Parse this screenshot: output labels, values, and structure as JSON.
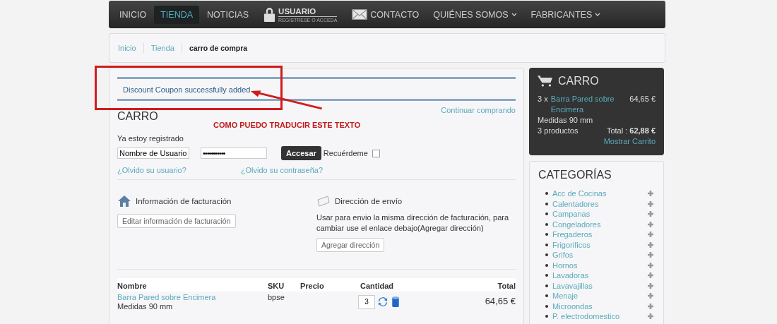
{
  "nav": [
    {
      "kind": "plain",
      "label": "INICIO",
      "selected": false
    },
    {
      "kind": "plain",
      "label": "TIENDA",
      "selected": true
    },
    {
      "kind": "plain",
      "label": "NOTICIAS",
      "selected": false
    },
    {
      "kind": "lock",
      "label": "USUARIO",
      "sub": "REGISTRESE O ACCEDA",
      "selected": false
    },
    {
      "kind": "mail",
      "label": "CONTACTO",
      "selected": false
    },
    {
      "kind": "dropdown",
      "label": "QUIÉNES SOMOS",
      "selected": false
    },
    {
      "kind": "dropdown",
      "label": "FABRICANTES",
      "selected": false
    }
  ],
  "breadcrumb": [
    {
      "label": "Inicio",
      "kind": "link"
    },
    {
      "label": "Tienda",
      "kind": "link"
    },
    {
      "label": "carro de compra",
      "kind": "current"
    }
  ],
  "message": "Discount Coupon successfully added",
  "annotation": "COMO PUEDO TRADUCIR ESTE TEXTO",
  "cart": {
    "title": "CARRO",
    "continue": "Continuar comprando",
    "login": {
      "label": "Ya estoy registrado",
      "username": "Nombre de Usuario",
      "password": "•••••••••••",
      "button": "Accesar",
      "remember": "Recuérdeme",
      "remember_checked": false,
      "forgot_user": "¿Olvido su usuario?",
      "forgot_password": "¿Olvido su contraseña?"
    },
    "billing": {
      "title": "Información de facturación",
      "button": "Editar información de facturación"
    },
    "shipping": {
      "title": "Dirección de envío",
      "text": "Usar para envio la misma dirección de facturación, para cambiar use el enlace debajo(Agregar dirección)",
      "button": "Agregar dirección"
    },
    "columns": [
      "Nombre",
      "SKU",
      "Precio",
      "Cantidad",
      "Total"
    ],
    "rows": [
      {
        "name": "Barra Pared sobre Encimera",
        "detail": "Medidas 90 mm",
        "sku": "bpse",
        "quantity": "3",
        "total": "64,65 €"
      }
    ]
  },
  "mini_cart": {
    "title": "CARRO",
    "quantity": "3 x",
    "item": "Barra Pared sobre Encimera",
    "price": "64,65 €",
    "detail": "Medidas 90 mm",
    "count": "3 productos",
    "total_label": "Total :",
    "total": "62,88 €",
    "show": "Mostrar Carrito"
  },
  "categories": {
    "title": "CATEGORÍAS",
    "items": [
      "Acc de Cocinas",
      "Calentadores",
      "Campanas",
      "Congeladores",
      "Fregaderos",
      "Frigorificos",
      "Grifos",
      "Hornos",
      "Lavadoras",
      "Lavavajillas",
      "Menaje",
      "Microondas",
      "P. electrodomestico"
    ]
  }
}
